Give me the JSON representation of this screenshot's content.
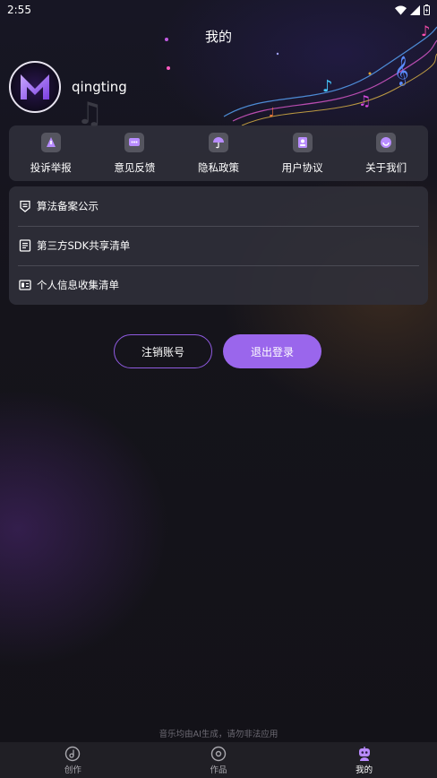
{
  "status_bar": {
    "time": "2:55"
  },
  "header": {
    "title": "我的"
  },
  "profile": {
    "username": "qingting",
    "avatar_letter": "M"
  },
  "quick_actions": [
    {
      "label": "投诉举报",
      "icon": "report-icon"
    },
    {
      "label": "意见反馈",
      "icon": "feedback-icon"
    },
    {
      "label": "隐私政策",
      "icon": "privacy-umbrella-icon"
    },
    {
      "label": "用户协议",
      "icon": "user-agreement-icon"
    },
    {
      "label": "关于我们",
      "icon": "about-us-icon"
    }
  ],
  "list": [
    {
      "label": "算法备案公示",
      "icon": "shield-doc-icon"
    },
    {
      "label": "第三方SDK共享清单",
      "icon": "document-list-icon"
    },
    {
      "label": "个人信息收集清单",
      "icon": "info-card-icon"
    }
  ],
  "buttons": {
    "cancel_account": "注销账号",
    "logout": "退出登录"
  },
  "footer": {
    "disclaimer": "音乐均由AI生成，请勿非法应用"
  },
  "tabbar": [
    {
      "label": "创作",
      "icon": "music-create-icon",
      "active": false
    },
    {
      "label": "作品",
      "icon": "disc-icon",
      "active": false
    },
    {
      "label": "我的",
      "icon": "robot-profile-icon",
      "active": true
    }
  ],
  "colors": {
    "accent": "#9a66ec",
    "accent_border": "#8f5ae0",
    "card_bg": "#30303a",
    "tab_bg": "#201f25"
  }
}
